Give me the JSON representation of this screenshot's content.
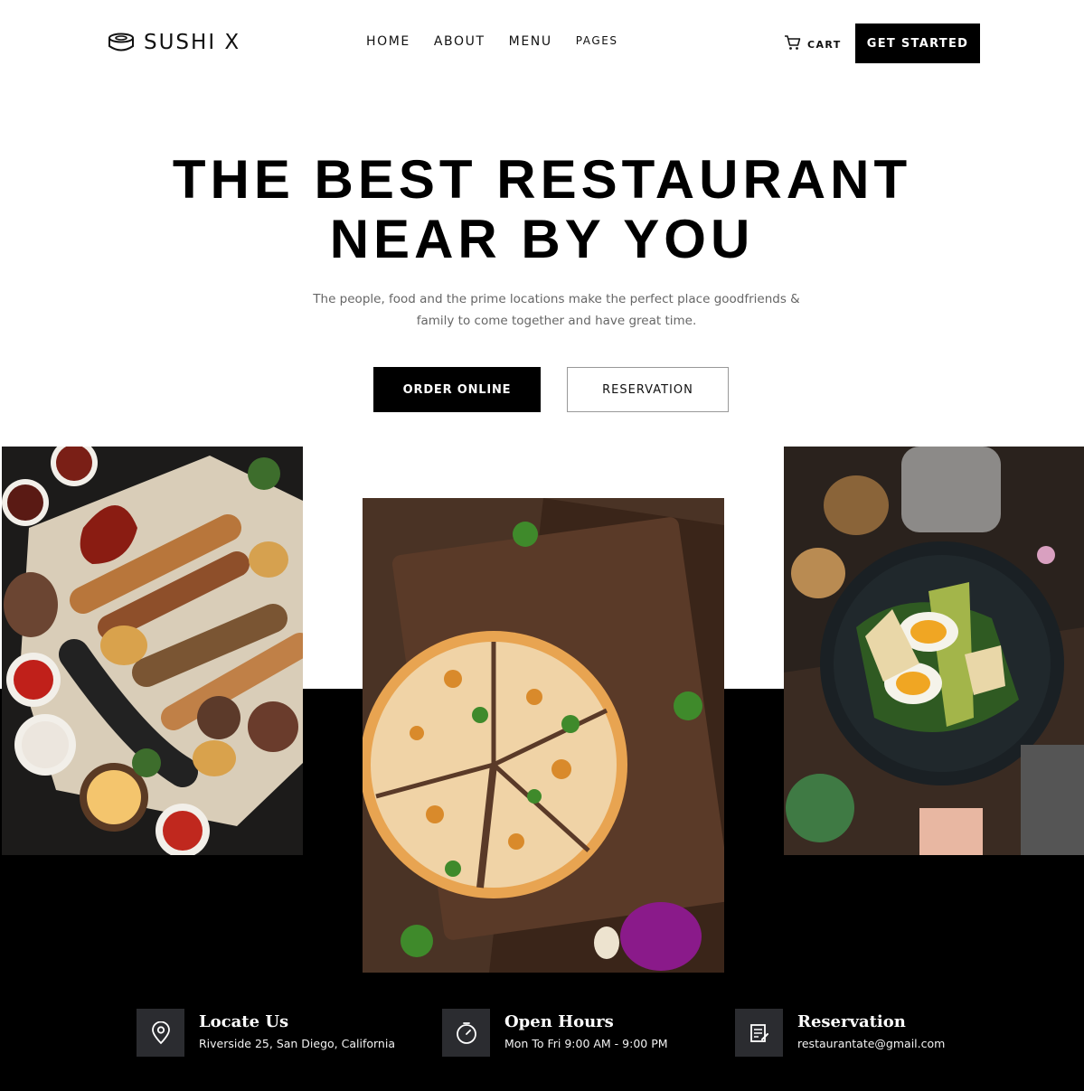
{
  "header": {
    "logo_text": "SUSHI X",
    "nav": [
      {
        "label": "HOME"
      },
      {
        "label": "ABOUT"
      },
      {
        "label": "MENU"
      },
      {
        "label": "PAGES"
      }
    ],
    "cart_label": "CART",
    "cta_label": "GET STARTED"
  },
  "hero": {
    "title_line1": "THE BEST RESTAURANT",
    "title_line2": "NEAR BY YOU",
    "subtitle": "The people, food and the prime locations make the perfect place goodfriends & family to come together and have great time.",
    "order_label": "ORDER ONLINE",
    "reservation_label": "RESERVATION"
  },
  "photos": [
    {
      "icon": "grilled-kebab-platter-image"
    },
    {
      "icon": "pizza-on-board-image"
    },
    {
      "icon": "egg-avocado-salad-image"
    }
  ],
  "info": [
    {
      "icon": "location-pin-icon",
      "title": "Locate Us",
      "detail": "Riverside 25, San Diego, California"
    },
    {
      "icon": "clock-icon",
      "title": "Open Hours",
      "detail": "Mon To Fri 9:00 AM - 9:00 PM"
    },
    {
      "icon": "reservation-form-icon",
      "title": "Reservation",
      "detail": "restaurantate@gmail.com"
    }
  ],
  "colors": {
    "background": "#ffffff",
    "band": "#000000",
    "icon_box": "#2b2c30",
    "primary_button": "#000000"
  }
}
